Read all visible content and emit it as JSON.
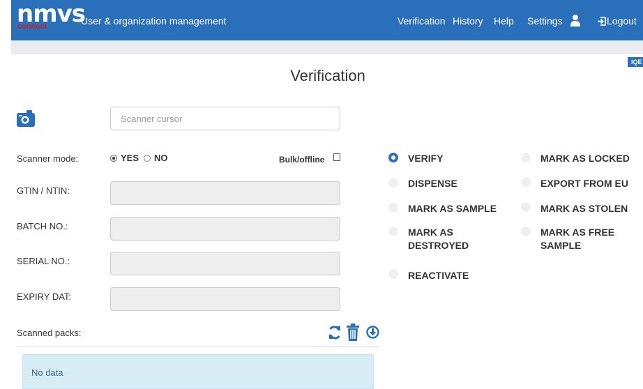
{
  "brand": {
    "logo_main": "nmvs",
    "logo_sub": "connect",
    "color_primary": "#2a6fba",
    "color_logo_sub": "#d11f26"
  },
  "header": {
    "app_title": "User & organization management",
    "nav": [
      "Verification",
      "History",
      "Help",
      "Settings"
    ],
    "user_icon": "user-icon",
    "logout_label": "Logout"
  },
  "badge": {
    "label": "IQE"
  },
  "page": {
    "title": "Verification"
  },
  "scanner": {
    "placeholder": "Scanner cursor",
    "value": ""
  },
  "form": {
    "scanner_mode_label": "Scanner mode:",
    "yes_label": "YES",
    "no_label": "NO",
    "scanner_mode_selected": "YES",
    "bulk_label": "Bulk/offline",
    "bulk_checked": false,
    "gtin_label": "GTIN / NTIN:",
    "batch_label": "BATCH NO.:",
    "serial_label": "SERIAL NO.:",
    "expiry_label": "EXPIRY DAT:",
    "gtin_value": "",
    "batch_value": "",
    "serial_value": "",
    "expiry_value": ""
  },
  "scanned": {
    "label": "Scanned packs:",
    "actions": [
      "refresh-icon",
      "trash-icon",
      "download-circle-icon"
    ],
    "empty_text": "No data"
  },
  "operations": {
    "selected": "VERIFY",
    "left": [
      {
        "line1": "VERIFY",
        "line2": ""
      },
      {
        "line1": "DISPENSE",
        "line2": ""
      },
      {
        "line1": "MARK AS SAMPLE",
        "line2": ""
      },
      {
        "line1": "MARK AS",
        "line2": "DESTROYED"
      },
      {
        "line1": "REACTIVATE",
        "line2": ""
      }
    ],
    "right": [
      {
        "line1": "MARK AS LOCKED",
        "line2": ""
      },
      {
        "line1": "EXPORT FROM EU",
        "line2": ""
      },
      {
        "line1": "MARK AS STOLEN",
        "line2": ""
      },
      {
        "line1": "MARK AS FREE",
        "line2": "SAMPLE"
      }
    ]
  }
}
